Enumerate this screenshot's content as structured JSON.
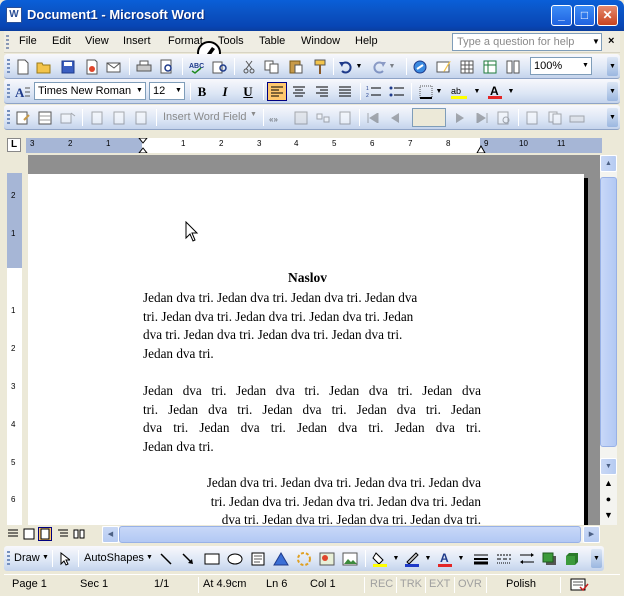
{
  "window": {
    "app_icon": "W",
    "title": "Document1 - Microsoft Word",
    "minimize_glyph": "_",
    "maximize_glyph": "□",
    "close_glyph": "✕"
  },
  "menu": {
    "items": [
      "File",
      "Edit",
      "View",
      "Insert",
      "Format",
      "Tools",
      "Table",
      "Window",
      "Help"
    ],
    "help_placeholder": "Type a question for help",
    "close_doc_glyph": "×"
  },
  "formatting": {
    "font": "Times New Roman",
    "size": "12",
    "bold": "B",
    "italic": "I",
    "underline": "U",
    "font_color_glyph": "A",
    "highlight_glyph": "ab"
  },
  "standard": {
    "zoom": "100%"
  },
  "mailmerge": {
    "insert_word_field": "Insert Word Field"
  },
  "ruler": {
    "tab_selector": "L",
    "h_numbers": [
      "3",
      "2",
      "1",
      "1",
      "2",
      "3",
      "4",
      "5",
      "6",
      "7",
      "8",
      "9",
      "10",
      "11"
    ],
    "v_numbers": [
      "2",
      "1",
      "1",
      "2",
      "3",
      "4",
      "5",
      "6"
    ]
  },
  "document": {
    "heading": "Naslov",
    "paragraphs": [
      [
        "Jedan dva tri. Jedan dva tri. Jedan dva tri. Jedan dva",
        "tri. Jedan dva tri. Jedan dva tri. Jedan dva tri. Jedan",
        "dva tri. Jedan dva tri. Jedan dva tri. Jedan dva tri.",
        "Jedan dva tri."
      ],
      [
        "Jedan dva tri. Jedan dva tri. Jedan dva tri. Jedan dva",
        "tri. Jedan dva tri. Jedan dva tri. Jedan dva tri. Jedan",
        "dva tri. Jedan dva tri. Jedan dva tri. Jedan dva tri.",
        "Jedan dva tri."
      ],
      [
        "Jedan dva tri. Jedan dva tri. Jedan dva tri. Jedan dva",
        "tri. Jedan dva tri. Jedan dva tri. Jedan dva tri. Jedan",
        "dva tri. Jedan dva tri. Jedan dva tri. Jedan dva tri."
      ]
    ]
  },
  "drawing": {
    "draw": "Draw",
    "autoshapes": "AutoShapes"
  },
  "status": {
    "page": "Page 1",
    "sec": "Sec 1",
    "page_of": "1/1",
    "at": "At 4.9cm",
    "ln": "Ln 6",
    "col": "Col 1",
    "rec": "REC",
    "trk": "TRK",
    "ext": "EXT",
    "ovr": "OVR",
    "language": "Polish"
  },
  "colors": {
    "title_bar": "#0A5FD8",
    "highlight": "#FFC86E",
    "toolbar": "#DCE6F5",
    "font_color_bar": "#E32626",
    "highlight_bar": "#FFFF00"
  }
}
